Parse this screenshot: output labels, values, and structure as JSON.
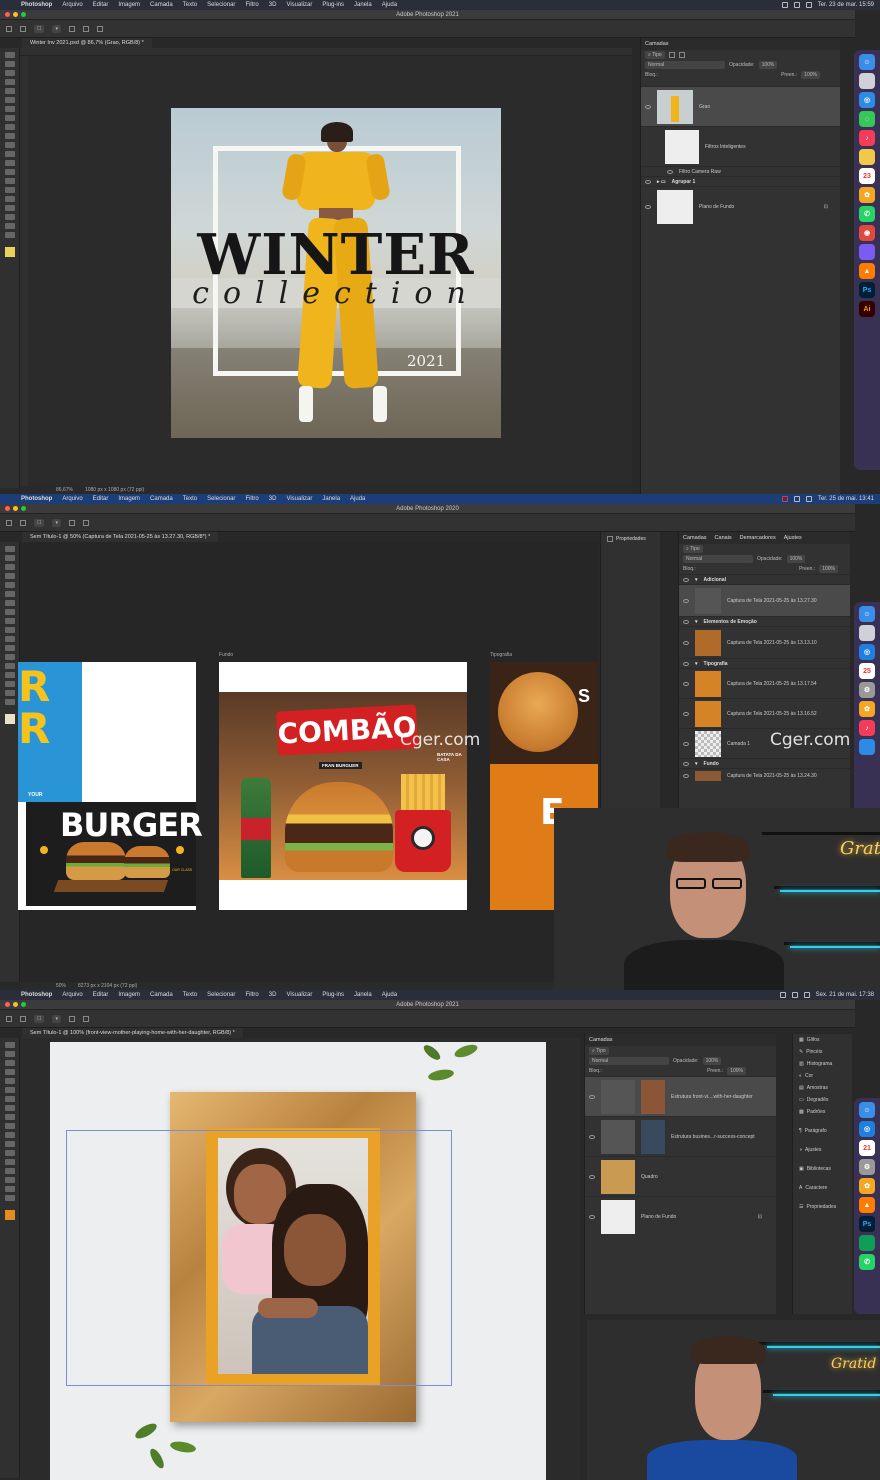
{
  "shot1": {
    "menubar": {
      "app": "Photoshop",
      "items": [
        "Arquivo",
        "Editar",
        "Imagem",
        "Camada",
        "Texto",
        "Selecionar",
        "Filtro",
        "3D",
        "Visualizar",
        "Plug-ins",
        "Janela",
        "Ajuda"
      ],
      "datetime": "Ter. 23 de mar. 15:59"
    },
    "window_title": "Adobe Photoshop 2021",
    "doc_tab": "Winter Inv 2021.psd @ 86,7% (Grao, RGB/8) *",
    "poster": {
      "title": "WINTER",
      "script": "collection",
      "year": "2021"
    },
    "status": {
      "zoom": "86,67%",
      "doc_size": "1080 px x 1080 px (72 ppi)"
    },
    "layers_panel": {
      "header": "Camadas",
      "kind_filter": "Tipo",
      "blend_mode": "Normal",
      "opacity_label": "Opacidade:",
      "opacity_value": "100%",
      "fill_label": "Preen.:",
      "fill_value": "100%",
      "lock_label": "Bloq.:",
      "layers": [
        {
          "name": "Grao",
          "selected": true
        },
        {
          "name": "Filtros Inteligentes"
        },
        {
          "name": "Filtro Camera Raw"
        },
        {
          "name": "Agrupar 1"
        },
        {
          "name": "Plano de Fundo"
        }
      ]
    },
    "dock_icons": [
      "finder",
      "launchpad",
      "safari",
      "messages",
      "music",
      "notes",
      "calendar",
      "photos",
      "whatsapp",
      "chrome",
      "affinity",
      "illustrator",
      "photoshop",
      "vlc"
    ]
  },
  "shot2": {
    "menubar": {
      "app": "Photoshop",
      "items": [
        "Arquivo",
        "Editar",
        "Imagem",
        "Camada",
        "Texto",
        "Selecionar",
        "Filtro",
        "3D",
        "Visualizar",
        "Janela",
        "Ajuda"
      ],
      "datetime": "Ter. 25 de mai. 13:41"
    },
    "window_title": "Adobe Photoshop 2020",
    "doc_tab": "Sem Título-1 @ 50% (Captura de Tela 2021-05-25 às 13.27.30, RGB/8*) *",
    "artboards": {
      "left_label": "",
      "center_label": "Fundo",
      "right_label": "Tipografia",
      "burger_title": "BURGER",
      "burger_sub": "YOUR",
      "burger_small": "OUR CLASS",
      "combo_sign": "COMBÃO",
      "fran": "FRAN BURGUER",
      "batata": "BATATA DA CASA",
      "right_letter": "E",
      "right_word": "S"
    },
    "status": {
      "zoom": "50%",
      "doc_size": "8273 px x 2104 px (72 ppi)"
    },
    "properties_label": "Propriedades",
    "layers_panel": {
      "tabs": [
        "Camadas",
        "Canais",
        "Demarcadores",
        "Ajustes"
      ],
      "kind_filter": "Tipo",
      "blend_mode": "Normal",
      "opacity_label": "Opacidade:",
      "opacity_value": "100%",
      "fill_label": "Preen.:",
      "fill_value": "100%",
      "lock_label": "Bloq.:",
      "items": [
        {
          "type": "group",
          "name": "Adicional"
        },
        {
          "type": "layer",
          "name": "Captura de Tela 2021-05-25 às 13.27.30"
        },
        {
          "type": "group",
          "name": "Elementos de Emoção"
        },
        {
          "type": "layer",
          "name": "Captura de Tela 2021-05-25 às 13.13.10"
        },
        {
          "type": "group",
          "name": "Tipografia"
        },
        {
          "type": "layer",
          "name": "Captura de Tela 2021-05-25 às 13.17.54"
        },
        {
          "type": "layer",
          "name": "Captura de Tela 2021-05-25 às 13.16.52"
        },
        {
          "type": "layer",
          "name": "Camada 1"
        },
        {
          "type": "group",
          "name": "Fundo"
        },
        {
          "type": "layer",
          "name": "Captura de Tela 2021-05-25 às 13.24.30"
        }
      ]
    },
    "watermarks": [
      "Cger.com",
      "Cger.com"
    ],
    "webcam_sign": "Gratid"
  },
  "shot3": {
    "menubar": {
      "app": "Photoshop",
      "items": [
        "Arquivo",
        "Editar",
        "Imagem",
        "Camada",
        "Texto",
        "Selecionar",
        "Filtro",
        "3D",
        "Visualizar",
        "Plug-ins",
        "Janela",
        "Ajuda"
      ],
      "datetime": "Sex. 21 de mai. 17:38"
    },
    "window_title": "Adobe Photoshop 2021",
    "doc_tab": "Sem Título-1 @ 100% (front-view-mother-playing-home-with-her-daughter, RGB/8) *",
    "layers_panel": {
      "header": "Camadas",
      "kind_filter": "Tipo",
      "blend_mode": "Normal",
      "opacity_label": "Opacidade:",
      "opacity_value": "100%",
      "fill_label": "Preen.:",
      "fill_value": "100%",
      "lock_label": "Bloq.:",
      "layers": [
        {
          "name": "Estrutura front-vi....with-her-daughter"
        },
        {
          "name": "Estrutura busines...r-success-concept"
        },
        {
          "name": "Quadro"
        },
        {
          "name": "Plano de Fundo"
        }
      ]
    },
    "side_panels": [
      "Glifos",
      "Pincéis",
      "Histograma",
      "Cor",
      "Amostras",
      "Degradês",
      "Padrões",
      "Parágrafo",
      "Ajustes",
      "Bibliotecas",
      "Caractere",
      "Propriedades"
    ],
    "webcam_sign": "Gratid"
  },
  "colors": {
    "ps_bg": "#282828",
    "ps_panel": "#323232",
    "menubar_dark": "#2a2d3a",
    "menubar_blue": "#1c3d78",
    "hoodie_yellow": "#f0b51c",
    "combo_red": "#d32023",
    "frame_gold": "#c99a52",
    "neon_cyan": "#2ad1f0",
    "right_orange": "#e07c18"
  }
}
